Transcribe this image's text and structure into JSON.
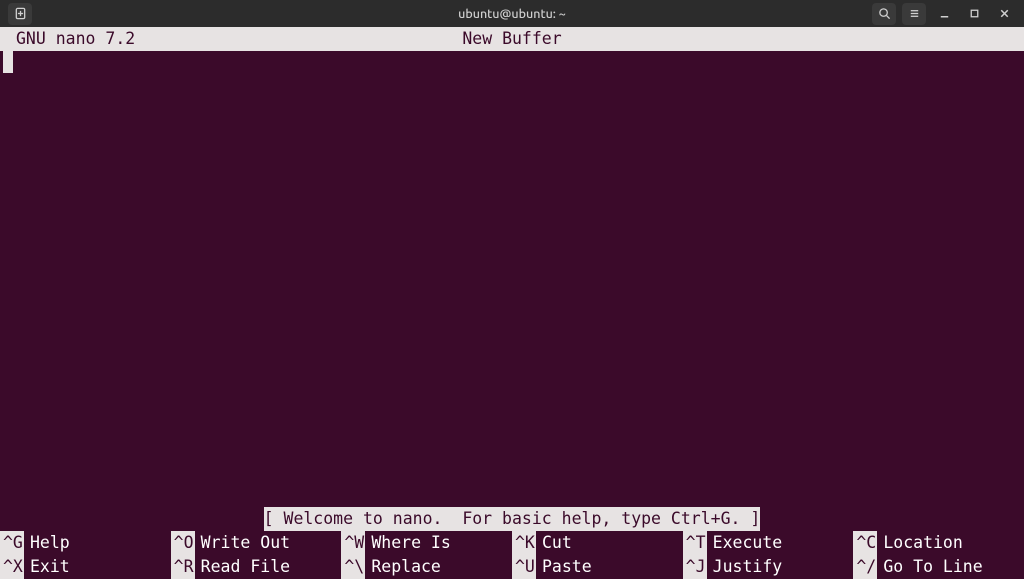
{
  "window": {
    "title": "ubuntu@ubuntu: ~"
  },
  "nano": {
    "app_version": "GNU nano 7.2",
    "buffer_name": "New Buffer",
    "status": "[ Welcome to nano.  For basic help, type Ctrl+G. ]"
  },
  "shortcuts": [
    {
      "key": "^G",
      "label": "Help"
    },
    {
      "key": "^X",
      "label": "Exit"
    },
    {
      "key": "^O",
      "label": "Write Out"
    },
    {
      "key": "^R",
      "label": "Read File"
    },
    {
      "key": "^W",
      "label": "Where Is"
    },
    {
      "key": "^\\",
      "label": "Replace"
    },
    {
      "key": "^K",
      "label": "Cut"
    },
    {
      "key": "^U",
      "label": "Paste"
    },
    {
      "key": "^T",
      "label": "Execute"
    },
    {
      "key": "^J",
      "label": "Justify"
    },
    {
      "key": "^C",
      "label": "Location"
    },
    {
      "key": "^/",
      "label": "Go To Line"
    }
  ]
}
